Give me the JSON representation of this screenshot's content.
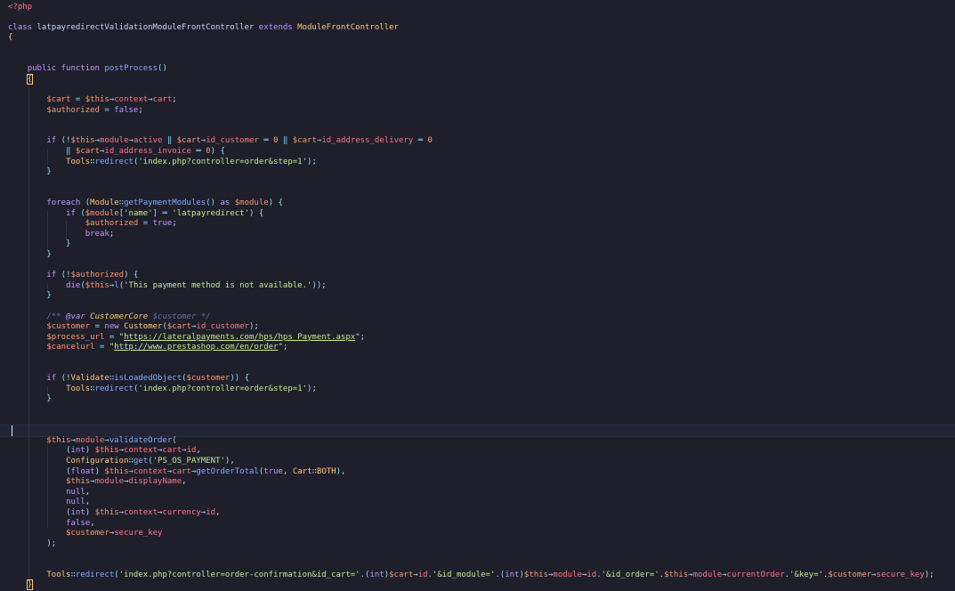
{
  "editor": {
    "language": "php",
    "class_name": "latpayredirectValidationModuleFrontController",
    "parent_class": "ModuleFrontController",
    "method_name": "postProcess",
    "lines": [
      "<?php",
      "",
      "class latpayredirectValidationModuleFrontController extends ModuleFrontController",
      "{",
      "",
      "",
      "    public function postProcess()",
      "    {",
      "",
      "        $cart = $this→context→cart;",
      "        $authorized = false;",
      "",
      "",
      "        if (!$this→module→active ‖ $cart→id_customer ═ 0 ‖ $cart→id_address_delivery ═ 0",
      "            ‖ $cart→id_address_invoice ═ 0) {",
      "            Tools∷redirect('index.php?controller=order&step=1');",
      "        }",
      "",
      "",
      "        foreach (Module∷getPaymentModules() as $module) {",
      "            if ($module['name'] ═ 'latpayredirect') {",
      "                $authorized = true;",
      "                break;",
      "            }",
      "        }",
      "",
      "        if (!$authorized) {",
      "            die($this→l('This payment method is not available.'));",
      "        }",
      "",
      "        /** @var CustomerCore $customer */",
      "        $customer = new Customer($cart→id_customer);",
      "        $process_url = \"https://lateralpayments.com/hps/hps_Payment.aspx\";",
      "        $cancelurl = \"http://www.prestashop.com/en/order\";",
      "",
      "",
      "        if (!Validate∷isLoadedObject($customer)) {",
      "            Tools∷redirect('index.php?controller=order&step=1');",
      "        }",
      "",
      "",
      "",
      "        $this→module→validateOrder(",
      "            (int) $this→context→cart→id,",
      "            Configuration∷get('PS_OS_PAYMENT'),",
      "            (float) $this→context→cart→getOrderTotal(true, Cart∷BOTH),",
      "            $this→module→displayName,",
      "            null,",
      "            null,",
      "            (int) $this→context→currency→id,",
      "            false,",
      "            $customer→secure_key",
      "        );",
      "",
      "",
      "        Tools∷redirect('index.php?controller=order-confirmation&id_cart='.(int)$cart→id.'&id_module='.(int)$this→module→id.'&id_order='.$this→module→currentOrder.'&key='.$customer→secure_key);",
      "    }",
      "}"
    ],
    "current_line": 41
  }
}
